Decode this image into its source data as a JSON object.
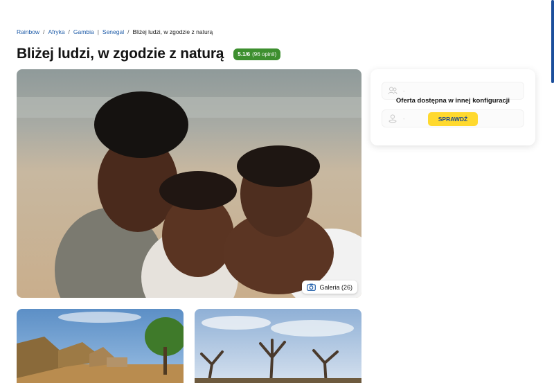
{
  "breadcrumb": {
    "items": [
      "Rainbow",
      "Afryka",
      "Gambia",
      "Senegal"
    ],
    "current": "Bliżej ludzi, w zgodzie z naturą",
    "separators": [
      "/",
      "/",
      "|",
      "/"
    ]
  },
  "header": {
    "title": "Bliżej ludzi, w zgodzie z naturą",
    "rating_score": "5.1/6",
    "rating_reviews": "(96 opinii)"
  },
  "gallery": {
    "button_label": "Galeria (26)",
    "icon": "camera-icon"
  },
  "offer_card": {
    "message": "Oferta dostępna w innej konfiguracji",
    "check_button": "SPRAWDŹ",
    "row_icons": [
      "people-icon",
      "location-person-icon"
    ],
    "placeholder": "-"
  },
  "colors": {
    "link": "#1f5ca8",
    "rating_badge": "#3d8f2f",
    "check_button_bg": "#ffd92e",
    "check_button_text": "#1f4a8c",
    "scrollbar": "#1c4f9c"
  }
}
